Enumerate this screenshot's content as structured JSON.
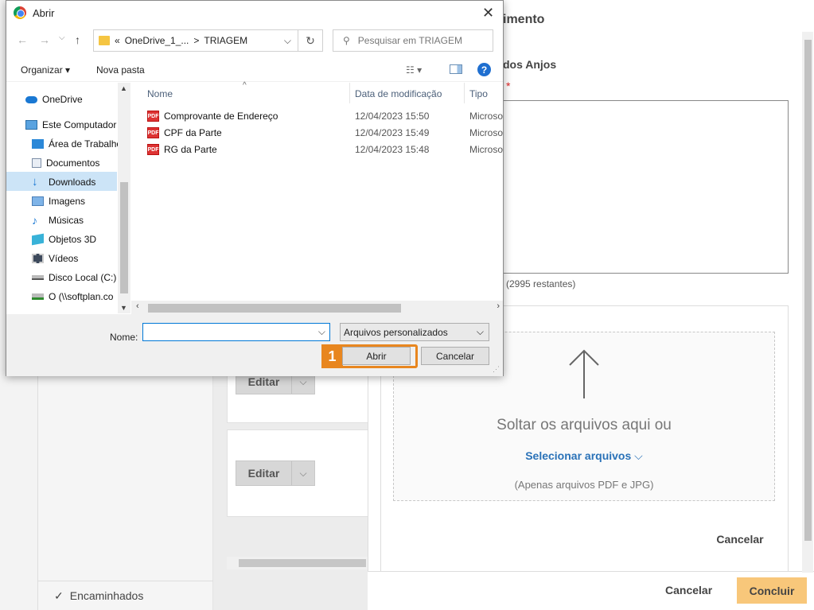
{
  "background": {
    "editar_label": "Editar",
    "encaminhados": "Encaminhados",
    "panel_title": "imento",
    "section_title": "dos Anjos",
    "counter": "(2995 restantes)",
    "drop_text": "Soltar os arquivos aqui ou",
    "select_files": "Selecionar arquivos",
    "hint": "(Apenas arquivos PDF e JPG)",
    "inner_cancel": "Cancelar",
    "footer_cancel": "Cancelar",
    "concluir": "Concluir",
    "colors": {
      "concluir_bg": "#f8c77a",
      "link": "#2a72b8"
    }
  },
  "dialog": {
    "title": "Abrir",
    "address": {
      "prefix": "«",
      "folder": "OneDrive_1_...",
      "sep": ">",
      "current": "TRIAGEM"
    },
    "search_placeholder": "Pesquisar em TRIAGEM",
    "toolbar": {
      "organize": "Organizar",
      "new_folder": "Nova pasta"
    },
    "tree": [
      {
        "label": "OneDrive",
        "icon": "cloud-icon"
      },
      {
        "label": "Este Computador",
        "icon": "computer-icon"
      },
      {
        "label": "Área de Trabalho",
        "icon": "desktop-icon"
      },
      {
        "label": "Documentos",
        "icon": "document-icon"
      },
      {
        "label": "Downloads",
        "icon": "download-icon",
        "selected": true
      },
      {
        "label": "Imagens",
        "icon": "image-icon"
      },
      {
        "label": "Músicas",
        "icon": "music-icon"
      },
      {
        "label": "Objetos 3D",
        "icon": "cube-icon"
      },
      {
        "label": "Vídeos",
        "icon": "video-icon"
      },
      {
        "label": "Disco Local (C:)",
        "icon": "drive-icon"
      },
      {
        "label": "O (\\\\softplan.co",
        "icon": "network-drive-icon"
      }
    ],
    "columns": {
      "name": "Nome",
      "date": "Data de modificação",
      "type": "Tipo"
    },
    "files": [
      {
        "name": "Comprovante de Endereço",
        "date": "12/04/2023 15:50",
        "type": "Microso"
      },
      {
        "name": "CPF da Parte",
        "date": "12/04/2023 15:49",
        "type": "Microso"
      },
      {
        "name": "RG da Parte",
        "date": "12/04/2023 15:48",
        "type": "Microso"
      }
    ],
    "name_label": "Nome:",
    "name_value": "",
    "filetype": "Arquivos personalizados",
    "open_button": "Abrir",
    "cancel_button": "Cancelar",
    "step_badge": "1",
    "colors": {
      "highlight": "#e8861f",
      "selection": "#cce4f7"
    }
  }
}
